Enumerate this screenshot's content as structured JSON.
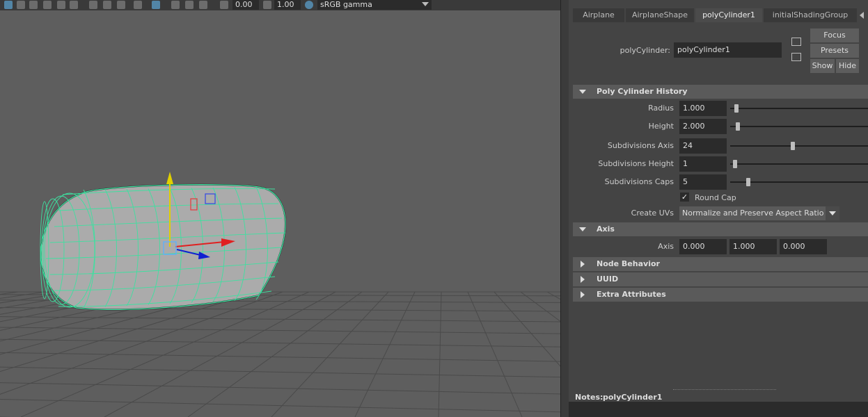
{
  "toolbar": {
    "exposure_value": "0.00",
    "gamma_value": "1.00",
    "colorspace": "sRGB gamma"
  },
  "tabs": [
    {
      "label": "Airplane"
    },
    {
      "label": "AirplaneShape"
    },
    {
      "label": "polyCylinder1"
    },
    {
      "label": "initialShadingGroup"
    }
  ],
  "header": {
    "node_type_label": "polyCylinder:",
    "node_name": "polyCylinder1",
    "focus_label": "Focus",
    "presets_label": "Presets",
    "show_label": "Show",
    "hide_label": "Hide"
  },
  "poly_history": {
    "title": "Poly Cylinder History",
    "radius": {
      "label": "Radius",
      "value": "1.000",
      "slider": 0.03
    },
    "height": {
      "label": "Height",
      "value": "2.000",
      "slider": 0.04
    },
    "subdiv_axis": {
      "label": "Subdivisions Axis",
      "value": "24",
      "slider": 0.46
    },
    "subdiv_height": {
      "label": "Subdivisions Height",
      "value": "1",
      "slider": 0.02
    },
    "subdiv_caps": {
      "label": "Subdivisions Caps",
      "value": "5",
      "slider": 0.12
    },
    "round_cap": {
      "label": "Round Cap",
      "checked": true
    },
    "create_uvs": {
      "label": "Create UVs",
      "value": "Normalize and Preserve Aspect Ratio"
    }
  },
  "axis_section": {
    "title": "Axis",
    "label": "Axis",
    "x": "0.000",
    "y": "1.000",
    "z": "0.000"
  },
  "collapsed_sections": [
    "Node Behavior",
    "UUID",
    "Extra Attributes"
  ],
  "notes": {
    "label": "Notes:",
    "node": "polyCylinder1"
  },
  "colors": {
    "wireframe": "#3ee0a0",
    "gizmo_x": "#e02020",
    "gizmo_y": "#e0d000",
    "gizmo_z": "#1020d0"
  }
}
